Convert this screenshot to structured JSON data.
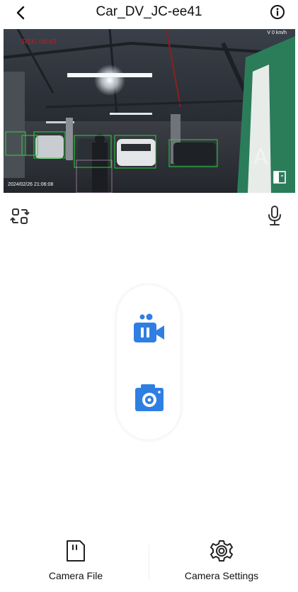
{
  "header": {
    "title": "Car_DV_JC-ee41",
    "back_icon": "chevron-left-icon",
    "info_icon": "info-circle-icon"
  },
  "video": {
    "overlay_rec": "REC 00:07",
    "speed": "V 0 km/h",
    "timestamp": "2024/02/26 21:06:08",
    "switch_icon": "switch-camera-icon",
    "bay_letter": "A",
    "box_color": "#27d43c"
  },
  "controls": {
    "left_icon": "flip-camera-icon",
    "right_icon": "microphone-icon",
    "record_icon": "record-pause-icon",
    "photo_icon": "capture-photo-icon",
    "accent_color": "#2f7fe3"
  },
  "bottom_nav": {
    "camera_file_label": "Camera File",
    "camera_settings_label": "Camera Settings"
  }
}
